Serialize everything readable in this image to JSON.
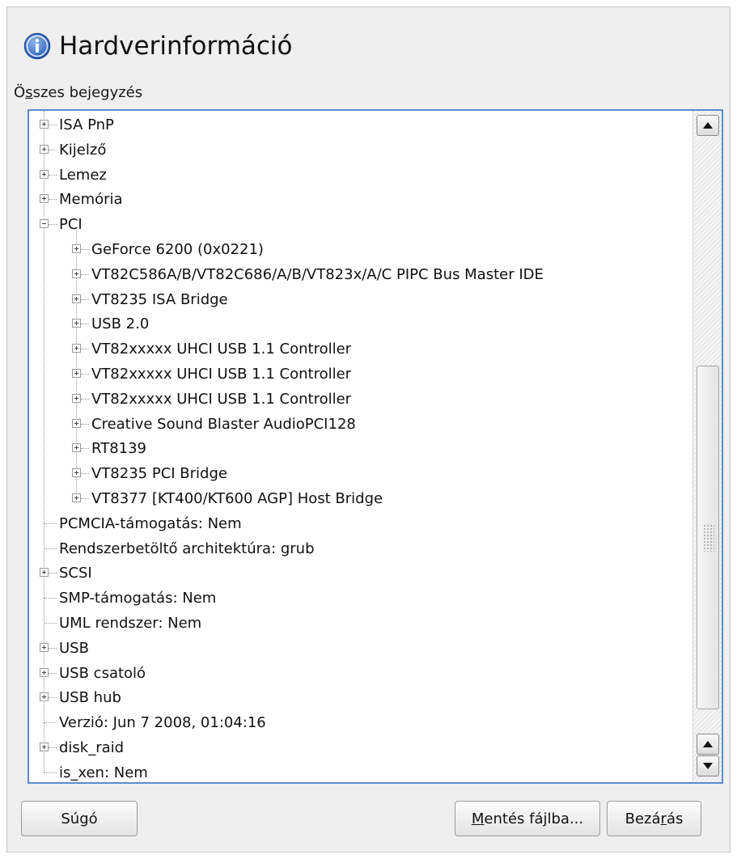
{
  "window": {
    "title": "Hardverinformáció",
    "section_label_pre": "Ö",
    "section_label_mn": "s",
    "section_label_post": "szes bejegyzés"
  },
  "tree": [
    {
      "label": "ISA PnP",
      "level": 0,
      "expander": "plus"
    },
    {
      "label": "Kijelző",
      "level": 0,
      "expander": "plus"
    },
    {
      "label": "Lemez",
      "level": 0,
      "expander": "plus"
    },
    {
      "label": "Memória",
      "level": 0,
      "expander": "plus"
    },
    {
      "label": "PCI",
      "level": 0,
      "expander": "minus"
    },
    {
      "label": "GeForce 6200 (0x0221)",
      "level": 1,
      "expander": "plus"
    },
    {
      "label": "VT82C586A/B/VT82C686/A/B/VT823x/A/C PIPC Bus Master IDE",
      "level": 1,
      "expander": "plus"
    },
    {
      "label": "VT8235 ISA Bridge",
      "level": 1,
      "expander": "plus"
    },
    {
      "label": "USB 2.0",
      "level": 1,
      "expander": "plus"
    },
    {
      "label": "VT82xxxxx UHCI USB 1.1 Controller",
      "level": 1,
      "expander": "plus"
    },
    {
      "label": "VT82xxxxx UHCI USB 1.1 Controller",
      "level": 1,
      "expander": "plus"
    },
    {
      "label": "VT82xxxxx UHCI USB 1.1 Controller",
      "level": 1,
      "expander": "plus"
    },
    {
      "label": "Creative Sound Blaster AudioPCI128",
      "level": 1,
      "expander": "plus"
    },
    {
      "label": "RT8139",
      "level": 1,
      "expander": "plus"
    },
    {
      "label": "VT8235 PCI Bridge",
      "level": 1,
      "expander": "plus"
    },
    {
      "label": "VT8377 [KT400/KT600 AGP] Host Bridge",
      "level": 1,
      "expander": "plus"
    },
    {
      "label": "PCMCIA-támogatás: Nem",
      "level": 0,
      "expander": "none"
    },
    {
      "label": "Rendszerbetöltő architektúra: grub",
      "level": 0,
      "expander": "none"
    },
    {
      "label": "SCSI",
      "level": 0,
      "expander": "plus"
    },
    {
      "label": "SMP-támogatás: Nem",
      "level": 0,
      "expander": "none"
    },
    {
      "label": "UML rendszer: Nem",
      "level": 0,
      "expander": "none"
    },
    {
      "label": "USB",
      "level": 0,
      "expander": "plus"
    },
    {
      "label": "USB csatoló",
      "level": 0,
      "expander": "plus"
    },
    {
      "label": "USB hub",
      "level": 0,
      "expander": "plus"
    },
    {
      "label": "Verzió: Jun  7 2008, 01:04:16",
      "level": 0,
      "expander": "none"
    },
    {
      "label": "disk_raid",
      "level": 0,
      "expander": "plus"
    },
    {
      "label": "is_xen: Nem",
      "level": 0,
      "expander": "none"
    }
  ],
  "buttons": {
    "help": {
      "label": "Súgó"
    },
    "save": {
      "pre": "",
      "mn": "M",
      "post": "entés fájlba..."
    },
    "close": {
      "pre": "Bezá",
      "mn": "r",
      "post": "ás"
    }
  }
}
